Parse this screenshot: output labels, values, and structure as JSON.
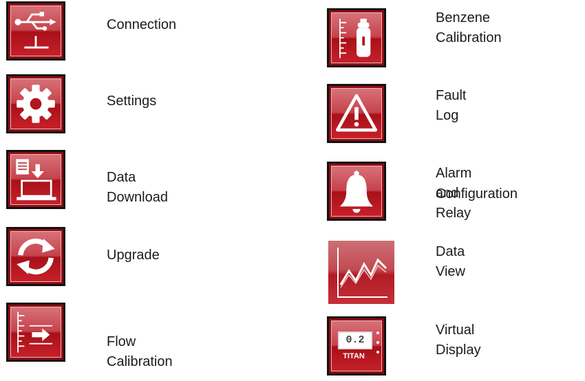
{
  "menu": {
    "left": [
      {
        "label": "Connection",
        "icon": "usb-icon"
      },
      {
        "label": "Settings",
        "icon": "gear-icon"
      },
      {
        "label": "Data Download",
        "icon": "download-to-laptop-icon"
      },
      {
        "label": "Upgrade",
        "icon": "refresh-icon"
      },
      {
        "label": "Flow Calibration",
        "icon": "flow-arrow-icon"
      }
    ],
    "right": [
      {
        "label": "Benzene Calibration",
        "icon": "gas-cylinder-icon"
      },
      {
        "label": "Fault Log",
        "icon": "warning-triangle-icon"
      },
      {
        "label": "Alarm and Relay",
        "label2": "Configuration",
        "icon": "bell-icon"
      },
      {
        "label": "Data View",
        "icon": "line-graph-icon"
      },
      {
        "label": "Virtual Display",
        "icon": "titan-display-icon",
        "display_value": "0.2",
        "display_brand": "TITAN"
      }
    ]
  },
  "colors": {
    "tile_dark": "#8c0f14",
    "tile_top": "#d8737a",
    "tile_bottom": "#c7212a",
    "icon": "#ffffff"
  }
}
